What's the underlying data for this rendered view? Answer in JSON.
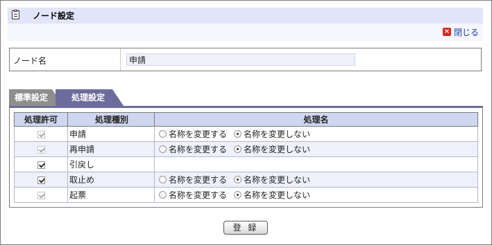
{
  "header": {
    "title": "ノード設定",
    "close_label": "閉じる"
  },
  "node": {
    "label": "ノード名",
    "value": "申請"
  },
  "tabs": [
    {
      "label": "標準設定",
      "active": false
    },
    {
      "label": "処理設定",
      "active": true
    }
  ],
  "table": {
    "headers": [
      "処理許可",
      "処理種別",
      "処理名"
    ],
    "radio_options": [
      "名称を変更する",
      "名称を変更しない"
    ],
    "rows": [
      {
        "allowed": true,
        "disabled": true,
        "type": "申請",
        "has_radio": true,
        "selected": "名称を変更しない"
      },
      {
        "allowed": true,
        "disabled": true,
        "type": "再申請",
        "has_radio": true,
        "selected": "名称を変更しない"
      },
      {
        "allowed": true,
        "disabled": false,
        "type": "引戻し",
        "has_radio": false,
        "selected": ""
      },
      {
        "allowed": true,
        "disabled": false,
        "type": "取止め",
        "has_radio": true,
        "selected": "名称を変更しない"
      },
      {
        "allowed": true,
        "disabled": true,
        "type": "起票",
        "has_radio": true,
        "selected": "名称を変更しない"
      }
    ]
  },
  "actions": {
    "register_label": "登 録"
  },
  "colors": {
    "header_bg": "#e2e4f8",
    "tab_active": "#6c6c9c",
    "tab_inactive": "#8e8e8e",
    "table_header": "#cfd6ef",
    "row_alt": "#eef0fb"
  }
}
